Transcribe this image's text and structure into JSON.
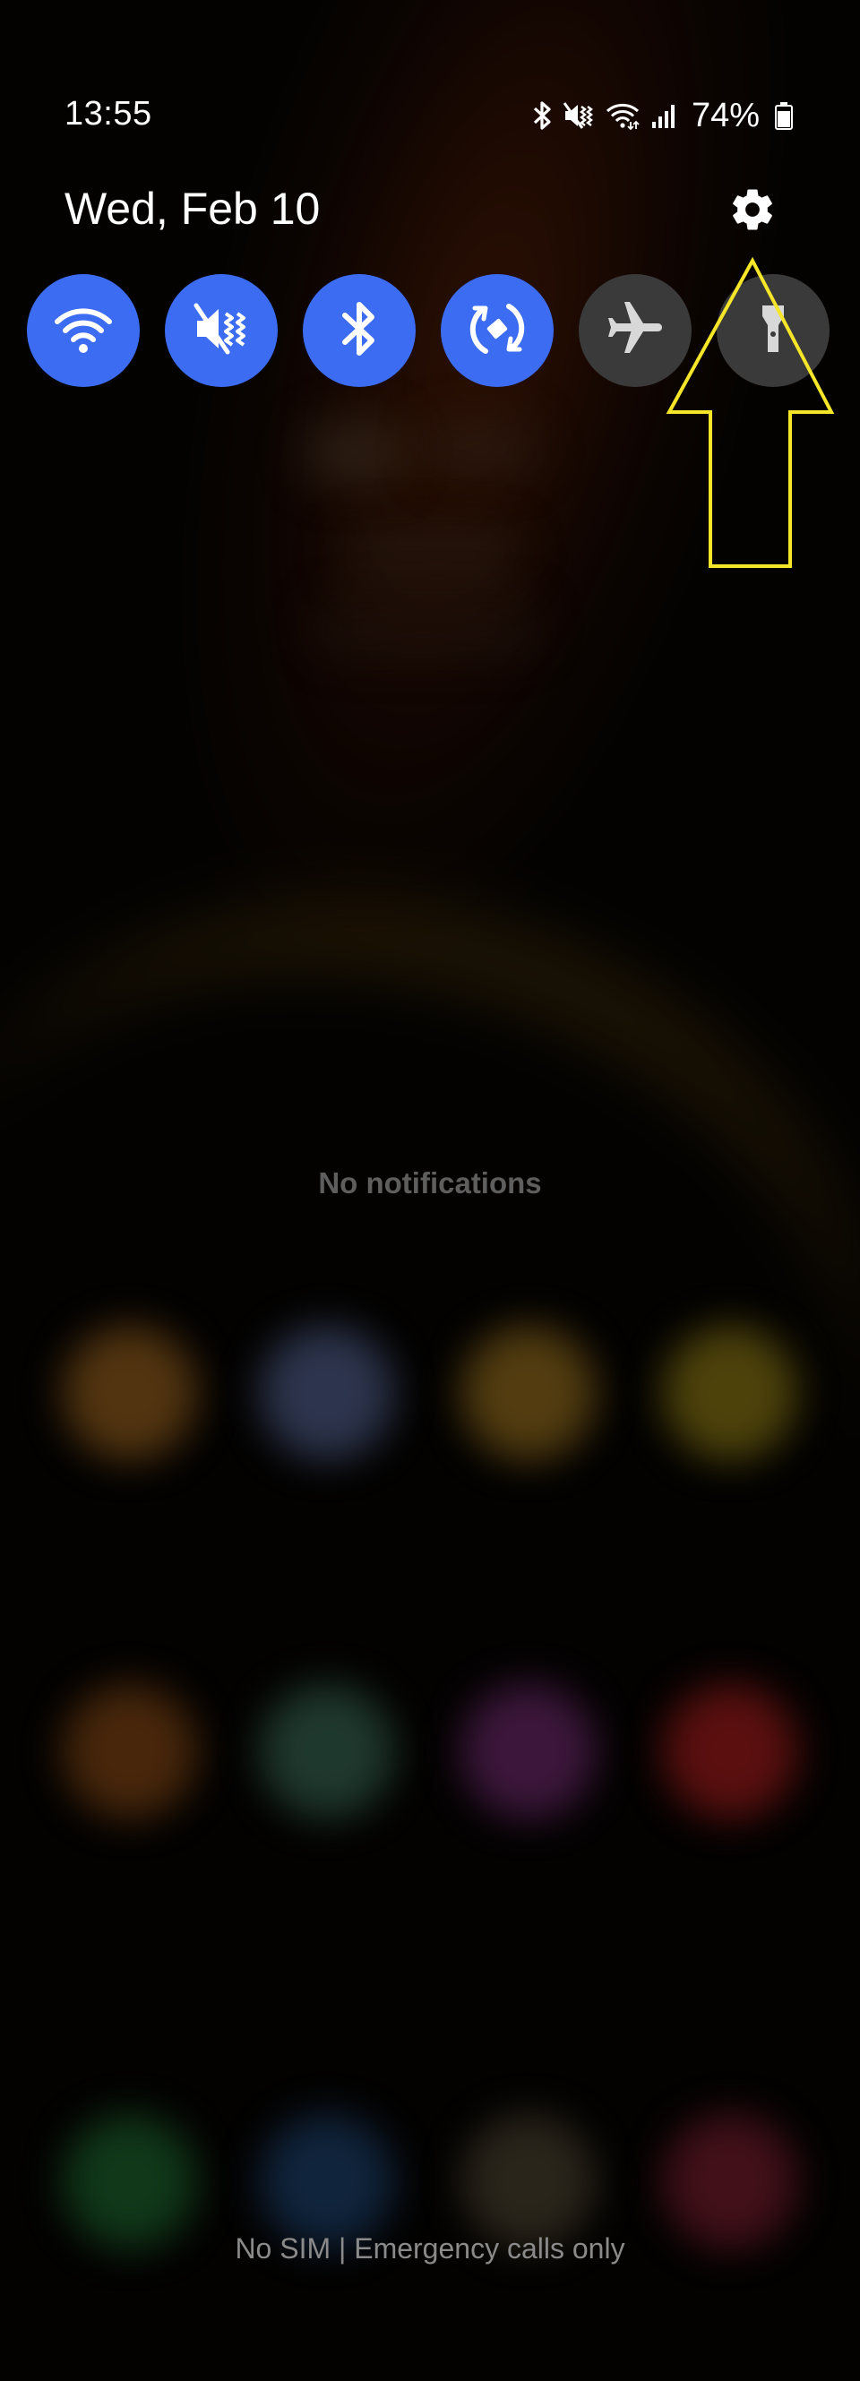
{
  "status_bar": {
    "time": "13:55",
    "battery_percent": "74%",
    "icons": [
      "bluetooth-icon",
      "vibrate-mute-icon",
      "wifi-icon",
      "signal-icon",
      "battery-icon"
    ]
  },
  "quick_panel": {
    "date": "Wed, Feb 10",
    "settings_icon": "gear-icon",
    "toggles": [
      {
        "name": "wifi",
        "icon": "wifi-icon",
        "state": "on"
      },
      {
        "name": "sound",
        "icon": "mute-icon",
        "state": "on"
      },
      {
        "name": "bluetooth",
        "icon": "bluetooth-icon",
        "state": "on"
      },
      {
        "name": "auto-rotate",
        "icon": "auto-rotate-icon",
        "state": "on"
      },
      {
        "name": "airplane-mode",
        "icon": "airplane-icon",
        "state": "off"
      },
      {
        "name": "flashlight",
        "icon": "flashlight-icon",
        "state": "off"
      }
    ]
  },
  "notifications": {
    "empty_text": "No notifications"
  },
  "lock_footer": {
    "carrier_text": "No SIM | Emergency calls only"
  },
  "annotation": {
    "arrow_color": "#f5e62a",
    "points_to": "gear-icon"
  },
  "colors": {
    "toggle_on": "#3b6cf2",
    "toggle_off": "#3a3a3a",
    "background": "#000000"
  }
}
